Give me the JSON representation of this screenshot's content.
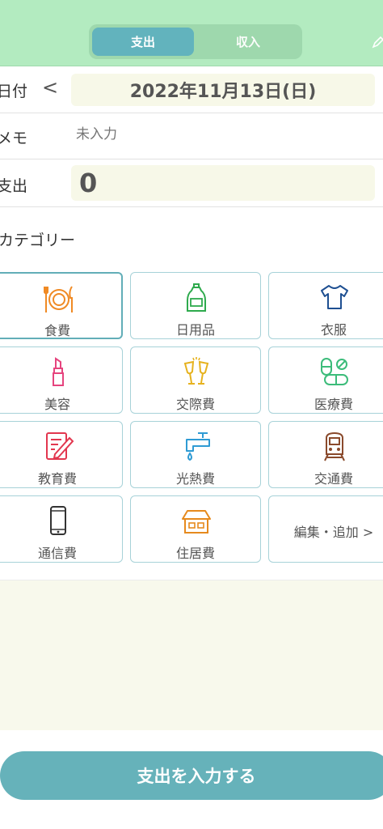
{
  "header": {
    "tabs": [
      {
        "label": "支出",
        "active": true
      },
      {
        "label": "収入",
        "active": false
      }
    ],
    "colors": {
      "header_bg": "#b3ebc0",
      "accent": "#62b3bd"
    }
  },
  "form": {
    "date_label": "日付",
    "date_prev_icon": "chevron-left-icon",
    "date_value": "2022年11月13日(日)",
    "memo_label": "メモ",
    "memo_placeholder": "未入力",
    "expense_label": "支出",
    "amount": "0"
  },
  "category": {
    "title": "カテゴリー",
    "items": [
      {
        "label": "食費",
        "icon": "food-icon",
        "selected": true
      },
      {
        "label": "日用品",
        "icon": "detergent-bottle-icon",
        "selected": false
      },
      {
        "label": "衣服",
        "icon": "shirt-icon",
        "selected": false
      },
      {
        "label": "美容",
        "icon": "lipstick-icon",
        "selected": false
      },
      {
        "label": "交際費",
        "icon": "toast-glasses-icon",
        "selected": false
      },
      {
        "label": "医療費",
        "icon": "pills-icon",
        "selected": false
      },
      {
        "label": "教育費",
        "icon": "notebook-pencil-icon",
        "selected": false
      },
      {
        "label": "光熱費",
        "icon": "faucet-icon",
        "selected": false
      },
      {
        "label": "交通費",
        "icon": "train-icon",
        "selected": false
      },
      {
        "label": "通信費",
        "icon": "smartphone-icon",
        "selected": false
      },
      {
        "label": "住居費",
        "icon": "house-icon",
        "selected": false
      }
    ],
    "edit_add_label": "編集・追加 >"
  },
  "submit_label": "支出を入力する"
}
